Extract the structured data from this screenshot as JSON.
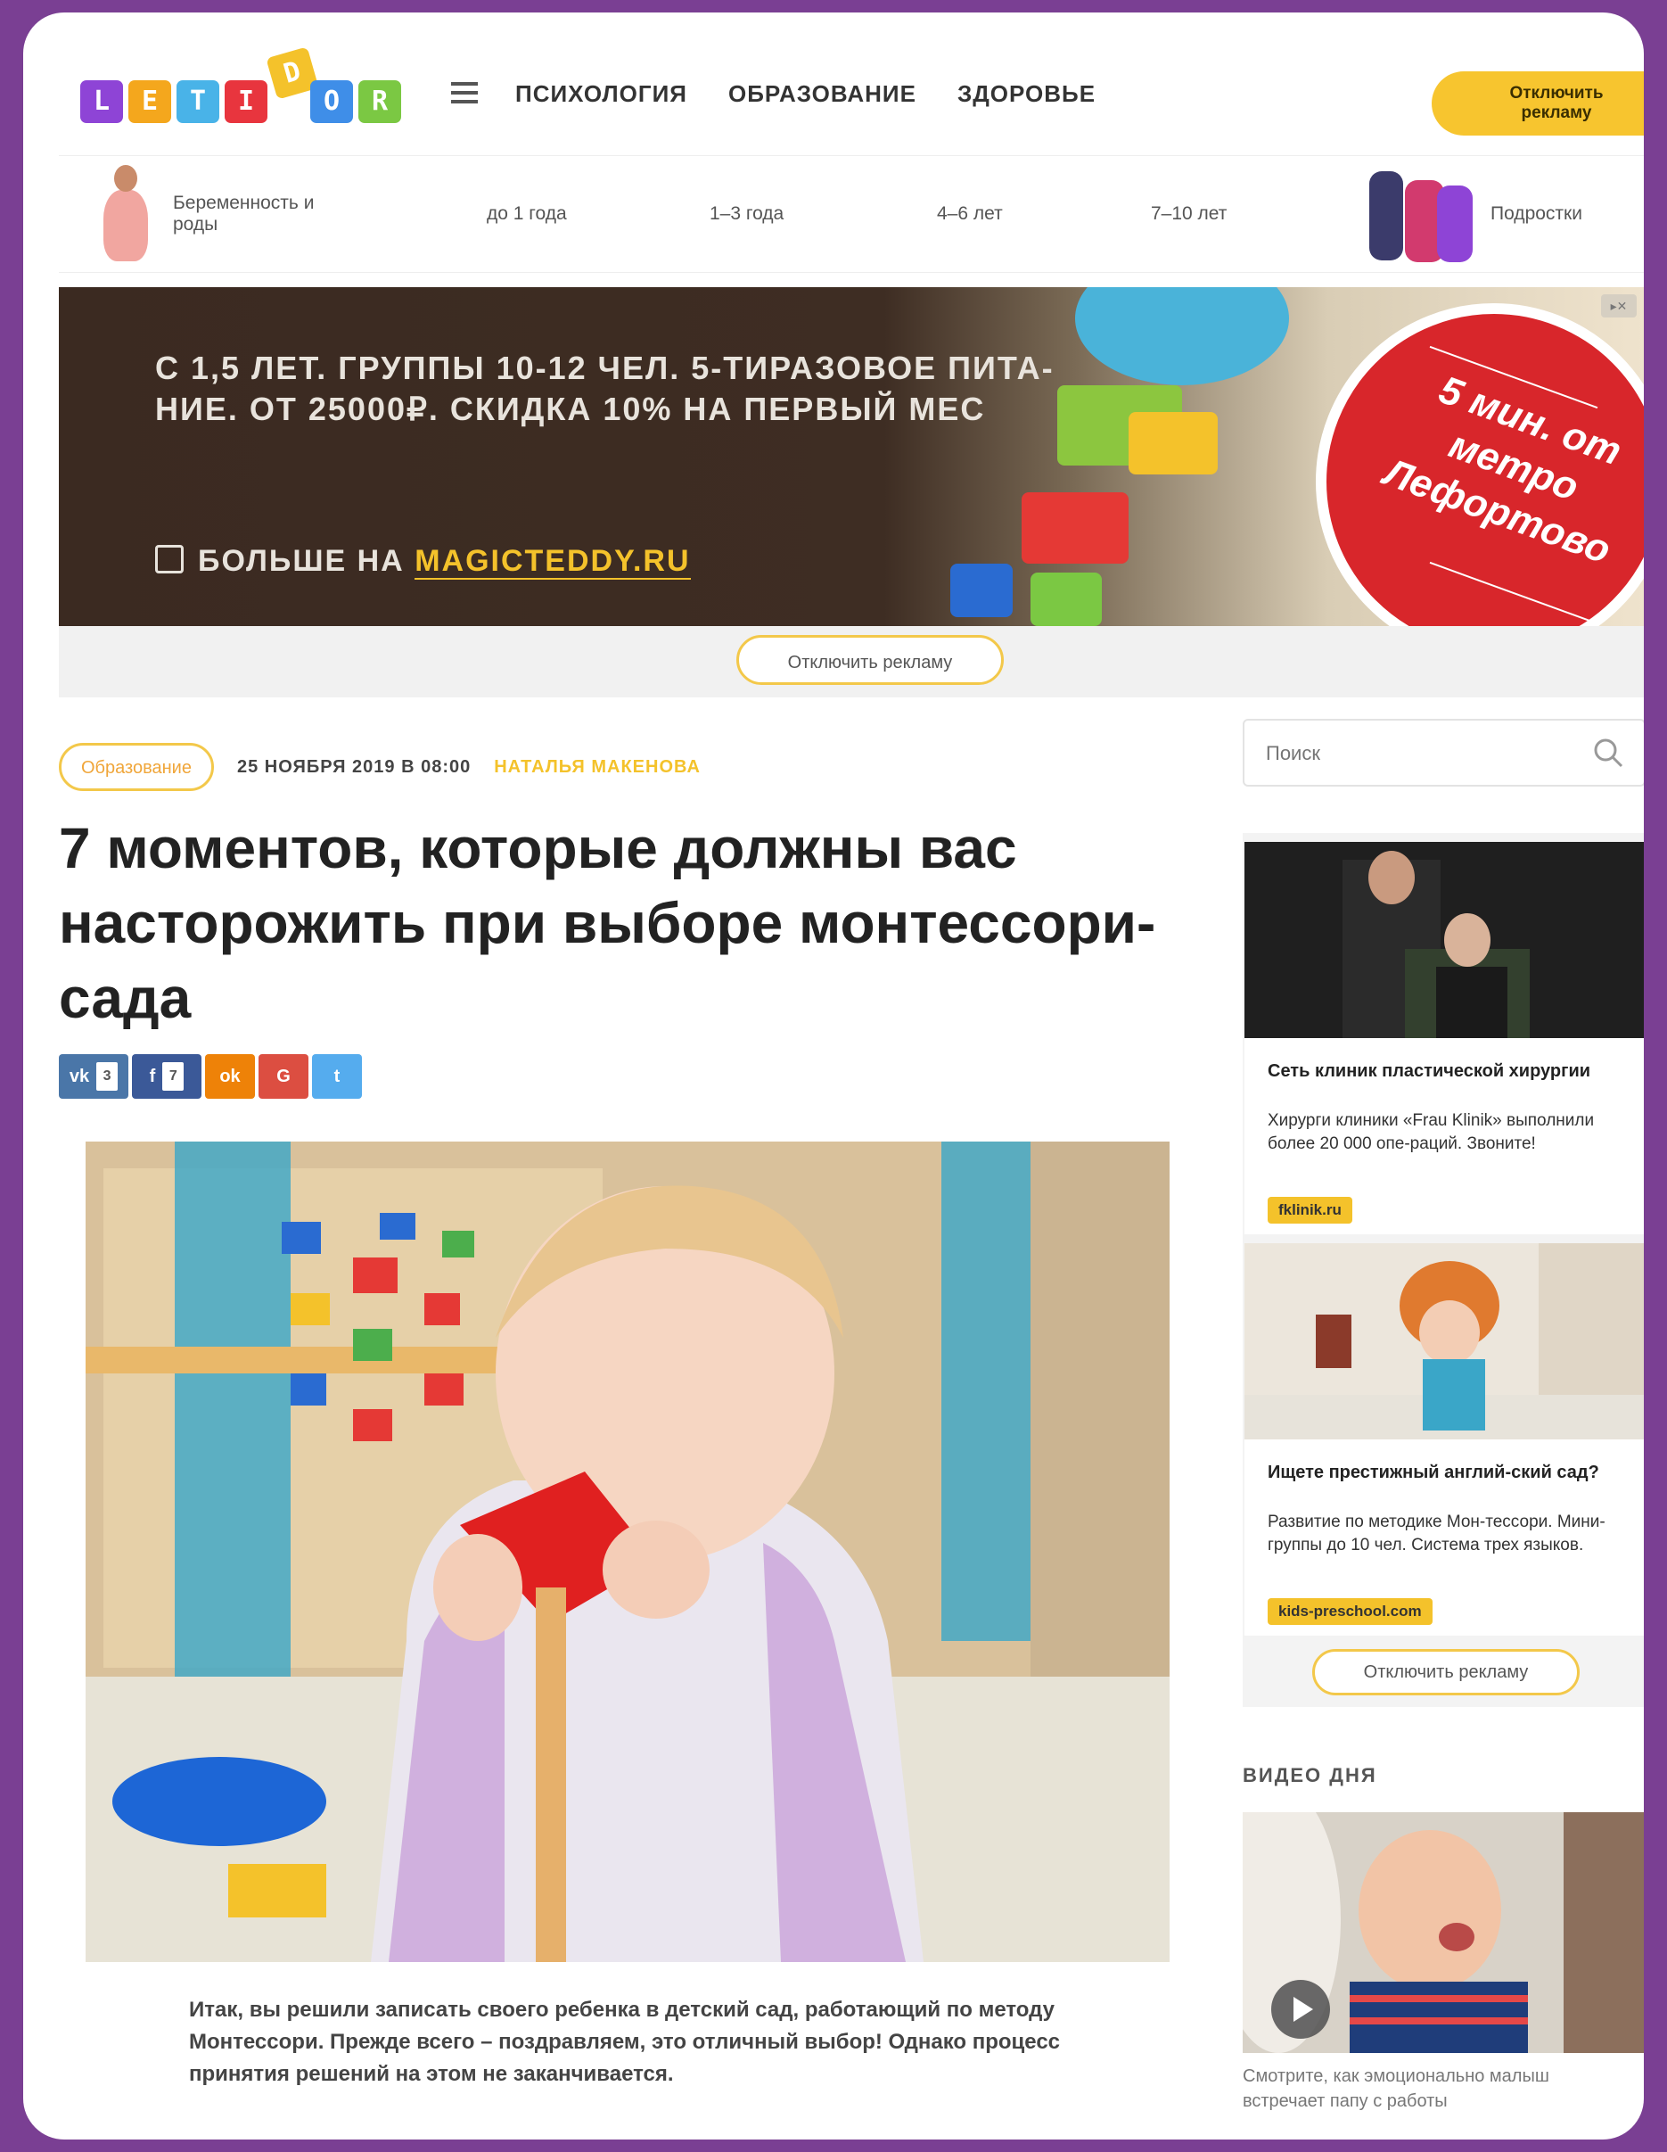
{
  "header": {
    "logo": [
      "L",
      "E",
      "T",
      "I",
      "D",
      "O",
      "R"
    ],
    "logo_colors": [
      "#8e44d6",
      "#f4a71d",
      "#49b3e8",
      "#e8353e",
      "#f4c22b",
      "#3f8ee8",
      "#7bc843"
    ],
    "nav": [
      "психология",
      "образование",
      "здоровье"
    ],
    "ad_off_label": "Отключить рекламу"
  },
  "agebar": {
    "items": [
      "Беременность и роды",
      "до 1 года",
      "1–3 года",
      "4–6 лет",
      "7–10 лет",
      "Подростки"
    ]
  },
  "banner": {
    "text": "С 1,5 ЛЕТ. ГРУППЫ 10-12 ЧЕЛ. 5-ТИРАЗОВОЕ ПИТА-НИЕ. ОТ 25000₽. СКИДКА 10% НА ПЕРВЫЙ МЕС",
    "more_prefix": "БОЛЬШЕ НА ",
    "more_site": "MAGICTEDDY.RU",
    "circle_text": "5 мин. от метро Лефортово",
    "ad_off_label": "Отключить рекламу"
  },
  "article": {
    "tag": "Образование",
    "date": "25 НОЯБРЯ 2019 В 08:00",
    "author": "НАТАЛЬЯ МАКЕНОВА",
    "title": "7 моментов, которые должны вас насторожить при выборе монтессори-сада",
    "share": [
      {
        "icon": "vk-icon",
        "label": "vk",
        "count": "3",
        "color": "#4a76a8"
      },
      {
        "icon": "facebook-icon",
        "label": "f",
        "count": "7",
        "color": "#3b5998"
      },
      {
        "icon": "odnoklassniki-icon",
        "label": "ok",
        "color": "#ee8208"
      },
      {
        "icon": "google-plus-icon",
        "label": "G",
        "color": "#dc4e41"
      },
      {
        "icon": "twitter-icon",
        "label": "t",
        "color": "#55acee"
      }
    ],
    "lead": "Итак, вы решили записать своего ребенка в детский сад, работающий по методу Монтессори. Прежде всего – поздравляем, это отличный выбор! Однако процесс принятия решений на этом не заканчивается."
  },
  "sidebar": {
    "search_placeholder": "Поиск",
    "ad1": {
      "title": "Сеть клиник пластической хирургии",
      "desc": "Хирурги клиники «Frau Klinik» выполнили более 20 000 опе-раций. Звоните!",
      "link": "fklinik.ru"
    },
    "ad2": {
      "title": "Ищете престижный англий-ский сад?",
      "desc": "Развитие по методике Мон-тессори. Мини-группы до 10 чел. Система трех языков.",
      "link": "kids-preschool.com"
    },
    "ad_off_label": "Отключить рекламу",
    "video_label": "ВИДЕО ДНЯ",
    "video_caption": "Смотрите, как эмоционально малыш встречает папу с работы"
  }
}
